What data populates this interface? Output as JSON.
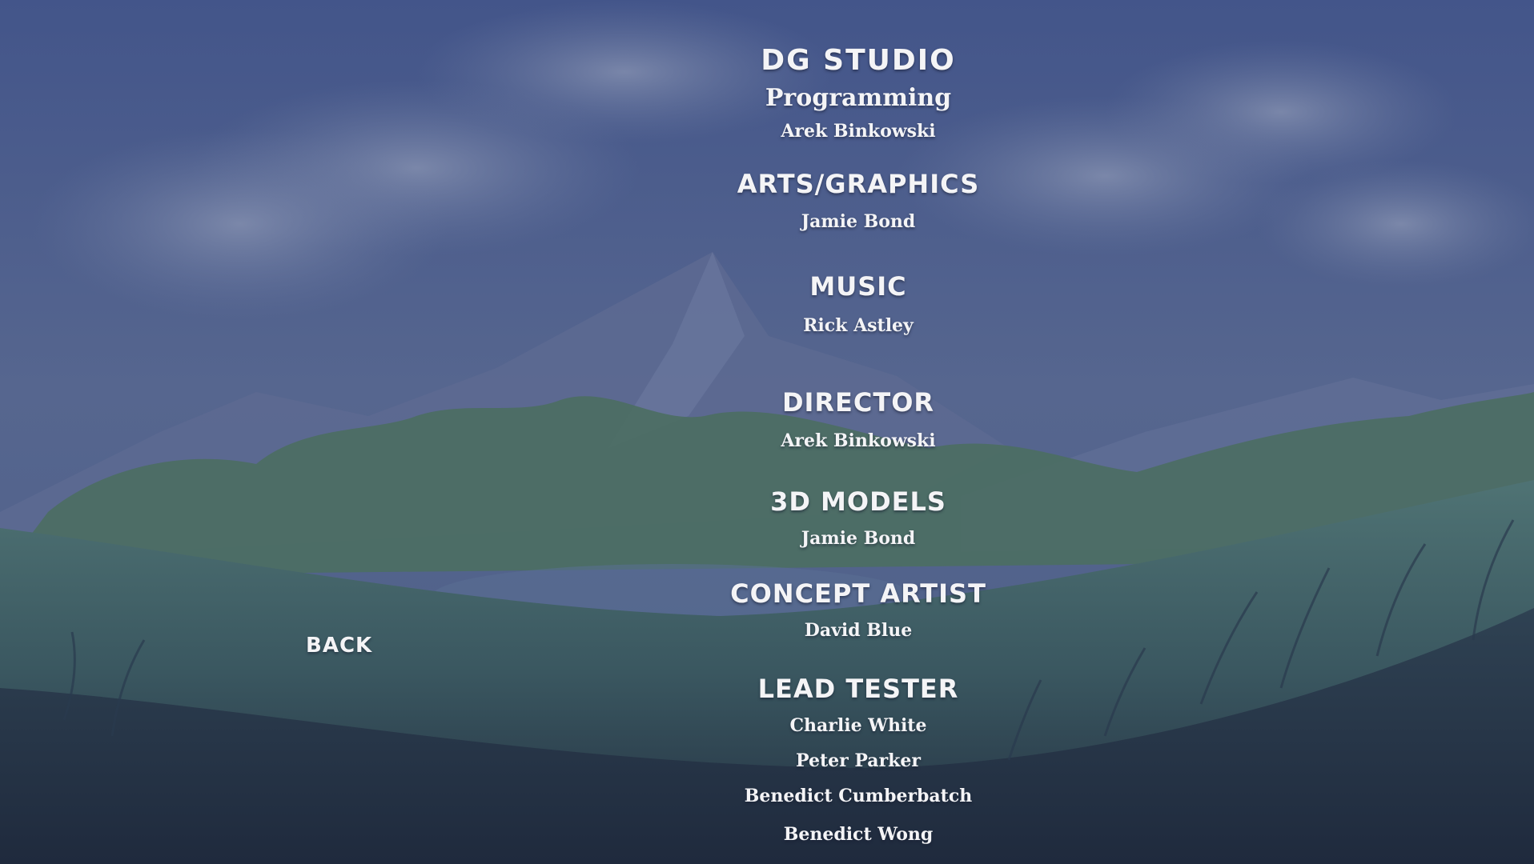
{
  "credits": {
    "studio": "DG STUDIO",
    "sections": [
      {
        "heading": "Programming",
        "names": [
          "Arek Binkowski"
        ]
      },
      {
        "heading": "ARTS/GRAPHICS",
        "names": [
          "Jamie Bond"
        ]
      },
      {
        "heading": "MUSIC",
        "names": [
          "Rick Astley"
        ]
      },
      {
        "heading": "DIRECTOR",
        "names": [
          "Arek Binkowski"
        ]
      },
      {
        "heading": "3D MODELS",
        "names": [
          "Jamie Bond"
        ]
      },
      {
        "heading": "CONCEPT ARTIST",
        "names": [
          "David Blue"
        ]
      },
      {
        "heading": "LEAD TESTER",
        "names": [
          "Charlie White",
          "Peter Parker",
          "Benedict Cumberbatch",
          "Benedict Wong"
        ]
      }
    ]
  },
  "nav": {
    "back_label": "BACK"
  },
  "colors": {
    "sky": "#4a5a86",
    "text": "#f4f4f6",
    "grass_dark": "#243246"
  }
}
